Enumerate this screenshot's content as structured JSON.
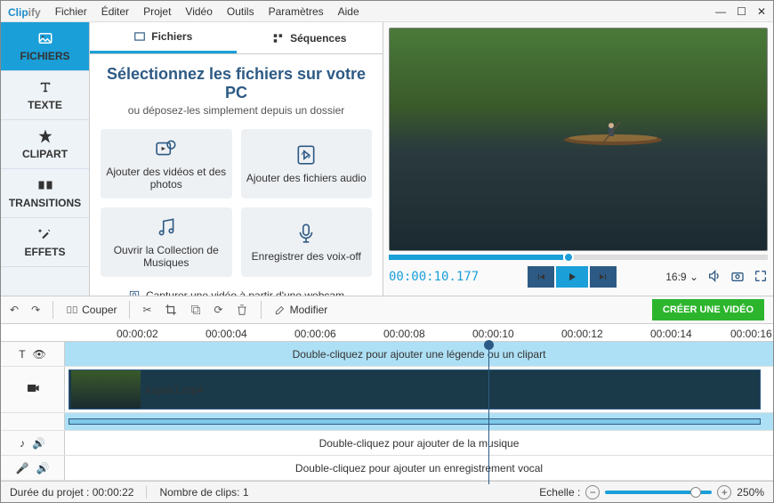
{
  "app": {
    "name": "Clip",
    "suffix": "ify"
  },
  "menu": [
    "Fichier",
    "Éditer",
    "Projet",
    "Vidéo",
    "Outils",
    "Paramètres",
    "Aide"
  ],
  "sidebar": [
    {
      "label": "FICHIERS"
    },
    {
      "label": "TEXTE"
    },
    {
      "label": "CLIPART"
    },
    {
      "label": "TRANSITIONS"
    },
    {
      "label": "EFFETS"
    }
  ],
  "panel": {
    "tabs": [
      "Fichiers",
      "Séquences"
    ],
    "title": "Sélectionnez les fichiers sur votre PC",
    "subtitle": "ou déposez-les simplement depuis un dossier",
    "cards": [
      "Ajouter des vidéos et des photos",
      "Ajouter des fichiers audio",
      "Ouvrir la Collection de Musiques",
      "Enregistrer des voix-off"
    ],
    "webcam": "Capturer une vidéo à partir d'une webcam"
  },
  "preview": {
    "time": "00:00:10.177",
    "ratio": "16:9"
  },
  "toolbar": {
    "cut": "Couper",
    "edit": "Modifier",
    "create": "CRÉER UNE VIDÉO"
  },
  "ruler": [
    "00:00:02",
    "00:00:04",
    "00:00:06",
    "00:00:08",
    "00:00:10",
    "00:00:12",
    "00:00:14",
    "00:00:16"
  ],
  "tracks": {
    "caption": "Double-cliquez pour ajouter une légende ou un clipart",
    "clip": "kayak1.mp4",
    "music": "Double-cliquez pour ajouter de la musique",
    "voice": "Double-cliquez pour ajouter un enregistrement vocal"
  },
  "status": {
    "duration_label": "Durée du projet :",
    "duration": "00:00:22",
    "clips_label": "Nombre de clips:",
    "clips": "1",
    "scale_label": "Echelle :",
    "zoom": "250%"
  }
}
